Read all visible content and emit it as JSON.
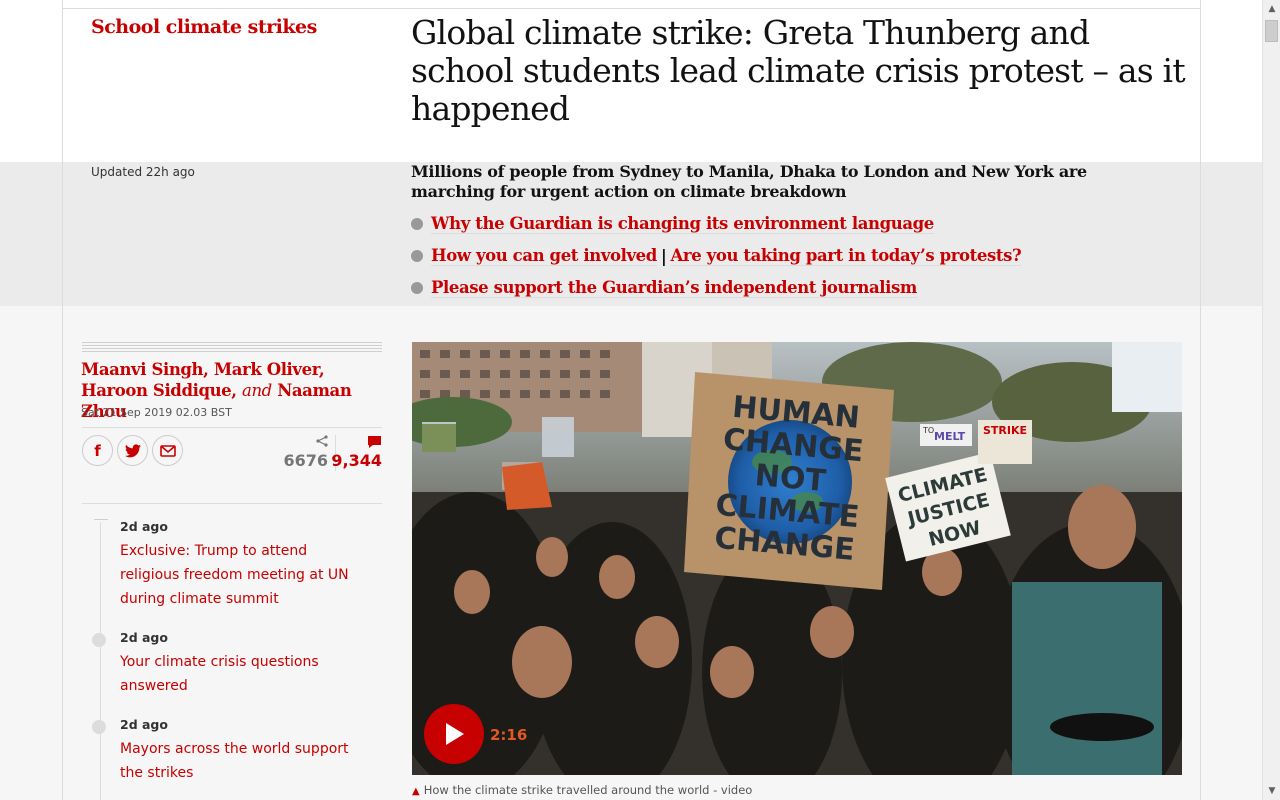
{
  "article": {
    "series": "School climate strikes",
    "headline": "Global climate strike: Greta Thunberg and school students lead climate crisis protest – as it happened",
    "updated": "Updated 22h ago",
    "standfirst": "Millions of people from Sydney to Manila, Dhaka to London and New York are marching for urgent action on climate breakdown",
    "links": {
      "link1": "Why the Guardian is changing its environment language",
      "link2a": "How you can get involved",
      "separator": "|",
      "link2b": "Are you taking part in today’s protests?",
      "link3": "Please support the Guardian’s independent journalism"
    }
  },
  "byline": {
    "author1": "Maanvi Singh",
    "author2": "Mark Oliver",
    "author3": "Haroon Siddique",
    "and_word": "and",
    "author4": "Naaman Zhou",
    "comma": ",",
    "date": "Sat 21 Sep 2019 02.03 BST"
  },
  "share": {
    "facebook_icon": "f",
    "share_count": "6676",
    "comment_count": "9,344"
  },
  "timeline": [
    {
      "time": "2d ago",
      "title": "Exclusive: Trump to attend religious freedom meeting at UN during climate summit"
    },
    {
      "time": "2d ago",
      "title": "Your climate crisis questions answered"
    },
    {
      "time": "2d ago",
      "title": "Mayors across the world support the strikes"
    }
  ],
  "media": {
    "duration": "2:16",
    "caption": "How the climate strike travelled around the world - video",
    "sign_main": [
      "HUMAN",
      "CHANGE",
      "NOT",
      "CLIMATE",
      "CHANGE"
    ],
    "sign_right": [
      "CLIMATE",
      "JUSTICE",
      "NOW"
    ],
    "sign_small": "STRIKE",
    "sign_small2": "MELT",
    "sign_small3": "TO"
  },
  "colors": {
    "accent": "#c70000",
    "grey_band": "#ebebeb",
    "light_band": "#f6f6f6"
  }
}
